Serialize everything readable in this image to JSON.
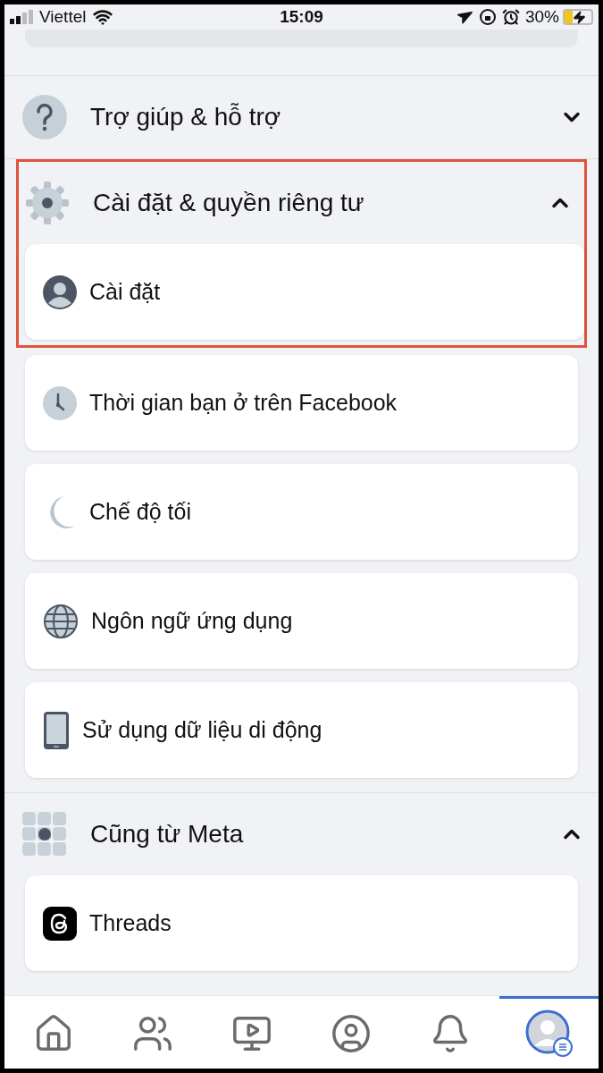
{
  "status_bar": {
    "carrier": "Viettel",
    "time": "15:09",
    "battery": "30%"
  },
  "sections": [
    {
      "kind": "help",
      "title": "Trợ giúp & hỗ trợ",
      "expanded": false,
      "highlighted": false
    },
    {
      "kind": "gear",
      "title": "Cài đặt & quyền riêng tư",
      "expanded": true,
      "highlighted": true,
      "items": [
        {
          "kind": "person",
          "label": "Cài đặt"
        },
        {
          "kind": "clock",
          "label": "Thời gian bạn ở trên Facebook"
        },
        {
          "kind": "moon",
          "label": "Chế độ tối"
        },
        {
          "kind": "globe",
          "label": "Ngôn ngữ ứng dụng"
        },
        {
          "kind": "phone",
          "label": "Sử dụng dữ liệu di động"
        }
      ]
    },
    {
      "kind": "grid",
      "title": "Cũng từ Meta",
      "expanded": true,
      "highlighted": false,
      "items": [
        {
          "kind": "threads",
          "label": "Threads"
        }
      ]
    }
  ],
  "bottom_nav": [
    {
      "kind": "home",
      "selected": false
    },
    {
      "kind": "friends",
      "selected": false
    },
    {
      "kind": "video",
      "selected": false
    },
    {
      "kind": "profile",
      "selected": false
    },
    {
      "kind": "bell",
      "selected": false
    },
    {
      "kind": "menu",
      "selected": true
    }
  ]
}
